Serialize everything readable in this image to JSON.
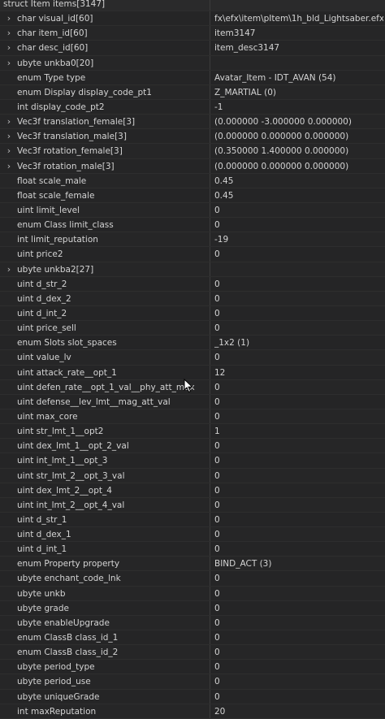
{
  "header": "struct Item items[3147]",
  "rows": [
    {
      "name": "char visual_id[60]",
      "value": "fx\\efx\\item\\pItem\\1h_bld_Lightsaber.efx",
      "expand": true
    },
    {
      "name": "char item_id[60]",
      "value": "item3147",
      "expand": true
    },
    {
      "name": "char desc_id[60]",
      "value": "item_desc3147",
      "expand": true
    },
    {
      "name": "ubyte unkba0[20]",
      "value": "",
      "expand": true
    },
    {
      "name": "enum Type type",
      "value": "Avatar_Item - IDT_AVAN (54)",
      "expand": false
    },
    {
      "name": "enum Display display_code_pt1",
      "value": "Z_MARTIAL (0)",
      "expand": false
    },
    {
      "name": "int display_code_pt2",
      "value": "-1",
      "expand": false
    },
    {
      "name": "Vec3f translation_female[3]",
      "value": "(0.000000 -3.000000 0.000000)",
      "expand": true
    },
    {
      "name": "Vec3f translation_male[3]",
      "value": "(0.000000 0.000000 0.000000)",
      "expand": true
    },
    {
      "name": "Vec3f rotation_female[3]",
      "value": "(0.350000 1.400000 0.000000)",
      "expand": true
    },
    {
      "name": "Vec3f rotation_male[3]",
      "value": "(0.000000 0.000000 0.000000)",
      "expand": true
    },
    {
      "name": "float scale_male",
      "value": "0.45",
      "expand": false
    },
    {
      "name": "float scale_female",
      "value": "0.45",
      "expand": false
    },
    {
      "name": "uint limit_level",
      "value": "0",
      "expand": false
    },
    {
      "name": "enum Class limit_class",
      "value": "0",
      "expand": false
    },
    {
      "name": "int limit_reputation",
      "value": "-19",
      "expand": false
    },
    {
      "name": "uint price2",
      "value": "0",
      "expand": false
    },
    {
      "name": "ubyte unkba2[27]",
      "value": "",
      "expand": true
    },
    {
      "name": "uint d_str_2",
      "value": "0",
      "expand": false
    },
    {
      "name": "uint d_dex_2",
      "value": "0",
      "expand": false
    },
    {
      "name": "uint d_int_2",
      "value": "0",
      "expand": false
    },
    {
      "name": "uint price_sell",
      "value": "0",
      "expand": false
    },
    {
      "name": "enum Slots slot_spaces",
      "value": "_1x2 (1)",
      "expand": false
    },
    {
      "name": "uint value_lv",
      "value": "0",
      "expand": false
    },
    {
      "name": "uint attack_rate__opt_1",
      "value": "12",
      "expand": false
    },
    {
      "name": "uint defen_rate__opt_1_val__phy_att_max",
      "value": "0",
      "expand": false
    },
    {
      "name": "uint defense__lev_lmt__mag_att_val",
      "value": "0",
      "expand": false
    },
    {
      "name": "uint max_core",
      "value": "0",
      "expand": false
    },
    {
      "name": "uint str_lmt_1__opt2",
      "value": "1",
      "expand": false
    },
    {
      "name": "uint dex_lmt_1__opt_2_val",
      "value": "0",
      "expand": false
    },
    {
      "name": "uint int_lmt_1__opt_3",
      "value": "0",
      "expand": false
    },
    {
      "name": "uint str_lmt_2__opt_3_val",
      "value": "0",
      "expand": false
    },
    {
      "name": "uint dex_lmt_2__opt_4",
      "value": "0",
      "expand": false
    },
    {
      "name": "uint int_lmt_2__opt_4_val",
      "value": "0",
      "expand": false
    },
    {
      "name": "uint d_str_1",
      "value": "0",
      "expand": false
    },
    {
      "name": "uint d_dex_1",
      "value": "0",
      "expand": false
    },
    {
      "name": "uint d_int_1",
      "value": "0",
      "expand": false
    },
    {
      "name": "enum Property property",
      "value": "BIND_ACT (3)",
      "expand": false
    },
    {
      "name": "ubyte enchant_code_lnk",
      "value": "0",
      "expand": false
    },
    {
      "name": "ubyte unkb",
      "value": "0",
      "expand": false
    },
    {
      "name": "ubyte grade",
      "value": "0",
      "expand": false
    },
    {
      "name": "ubyte enableUpgrade",
      "value": "0",
      "expand": false
    },
    {
      "name": "enum ClassB class_id_1",
      "value": "0",
      "expand": false
    },
    {
      "name": "enum ClassB class_id_2",
      "value": "0",
      "expand": false
    },
    {
      "name": "ubyte period_type",
      "value": "0",
      "expand": false
    },
    {
      "name": "ubyte period_use",
      "value": "0",
      "expand": false
    },
    {
      "name": "ubyte uniqueGrade",
      "value": "0",
      "expand": false
    },
    {
      "name": "int maxReputation",
      "value": "20",
      "expand": false
    }
  ],
  "icons": {
    "expand": "chevron-right-icon",
    "cursor": "mouse-pointer-icon"
  },
  "colors": {
    "background": "#252526",
    "text": "#d4d4d4",
    "divider": "#3c3c3c"
  }
}
